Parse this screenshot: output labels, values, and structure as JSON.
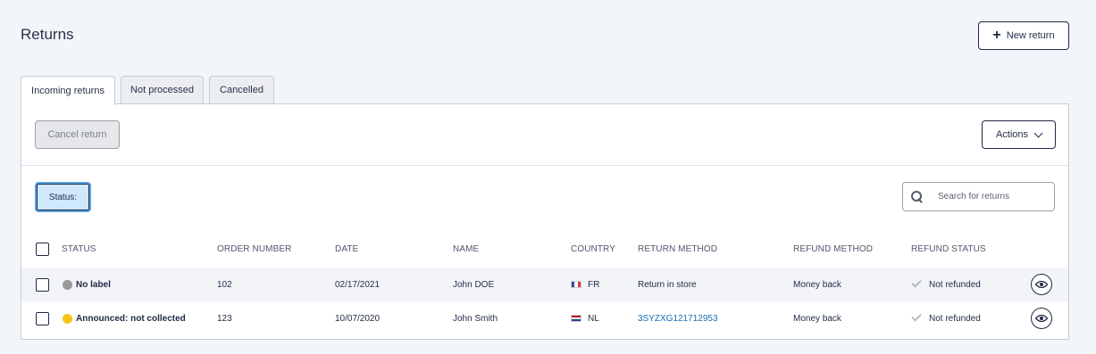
{
  "page": {
    "title": "Returns",
    "new_return_label": "New return"
  },
  "tabs": [
    {
      "label": "Incoming returns",
      "active": true
    },
    {
      "label": "Not processed",
      "active": false
    },
    {
      "label": "Cancelled",
      "active": false
    }
  ],
  "toolbar": {
    "cancel_label": "Cancel return",
    "actions_label": "Actions"
  },
  "filters": {
    "status_label": "Status:"
  },
  "search": {
    "placeholder": "Search for returns",
    "value": ""
  },
  "table": {
    "columns": [
      "STATUS",
      "ORDER NUMBER",
      "DATE",
      "NAME",
      "COUNTRY",
      "RETURN METHOD",
      "REFUND METHOD",
      "REFUND STATUS"
    ],
    "rows": [
      {
        "status": "No label",
        "status_color": "#9a9a9a",
        "order_number": "102",
        "date": "02/17/2021",
        "name": "John DOE",
        "country": "FR",
        "flag": "fr-flag-icon",
        "return_method": "Return in store",
        "refund_method": "Money back",
        "refund_status": "Not refunded"
      },
      {
        "status": "Announced: not collected",
        "status_color": "#f5c518",
        "order_number": "123",
        "date": "10/07/2020",
        "name": "John Smith",
        "country": "NL",
        "flag": "nl-flag-icon",
        "return_method": "3SYZXG121712953",
        "refund_method": "Money back",
        "refund_status": "Not refunded"
      }
    ]
  },
  "colors": {
    "accent": "#1f2a44",
    "link": "#1a6bb3",
    "filter_bg": "#cfe8fb"
  }
}
